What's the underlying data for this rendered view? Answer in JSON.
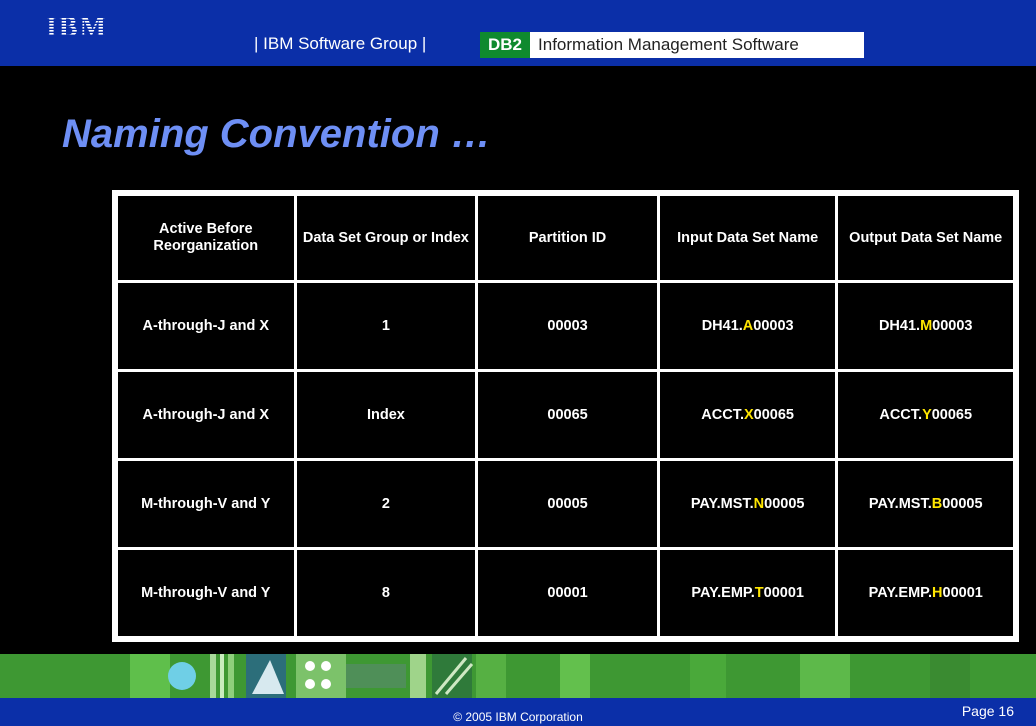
{
  "header": {
    "logo_text": "IBM",
    "group_text": "| IBM Software Group |",
    "db2_badge": "DB2",
    "product_text": "Information Management Software"
  },
  "title": "Naming Convention …",
  "table": {
    "headers": [
      "Active Before Reorganization",
      "Data Set Group or Index",
      "Partition ID",
      "Input Data Set Name",
      "Output Data Set Name"
    ],
    "rows": [
      {
        "active": "A-through-J and X",
        "group": "1",
        "partition": "00003",
        "input": {
          "prefix": "DH41.",
          "letter": "A",
          "suffix": "00003"
        },
        "output": {
          "prefix": "DH41.",
          "letter": "M",
          "suffix": "00003"
        }
      },
      {
        "active": "A-through-J and X",
        "group": "Index",
        "partition": "00065",
        "input": {
          "prefix": "ACCT.",
          "letter": "X",
          "suffix": "00065"
        },
        "output": {
          "prefix": "ACCT.",
          "letter": "Y",
          "suffix": "00065"
        }
      },
      {
        "active": "M-through-V and Y",
        "group": "2",
        "partition": "00005",
        "input": {
          "prefix": "PAY.MST.",
          "letter": "N",
          "suffix": "00005"
        },
        "output": {
          "prefix": "PAY.MST.",
          "letter": "B",
          "suffix": "00005"
        }
      },
      {
        "active": "M-through-V and Y",
        "group": "8",
        "partition": "00001",
        "input": {
          "prefix": "PAY.EMP.",
          "letter": "T",
          "suffix": "00001"
        },
        "output": {
          "prefix": "PAY.EMP.",
          "letter": "H",
          "suffix": "00001"
        }
      }
    ]
  },
  "footer": {
    "copyright": "© 2005 IBM Corporation",
    "page": "Page 16"
  },
  "colors": {
    "header_blue": "#0b2fa8",
    "title_blue": "#6e8ff5",
    "highlight_yellow": "#ffe600",
    "db2_green": "#0f8a2e"
  }
}
